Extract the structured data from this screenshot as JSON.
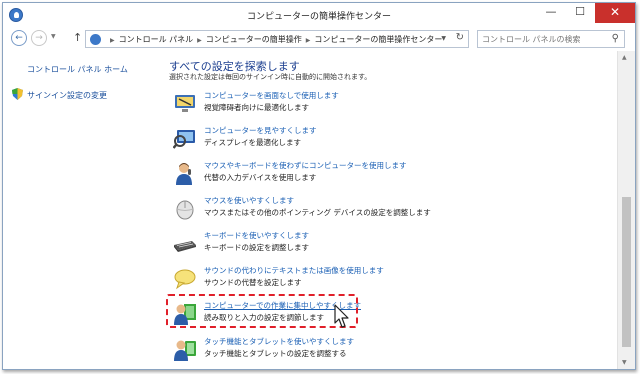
{
  "window": {
    "title": "コンピューターの簡単操作センター",
    "minimize_glyph": "—",
    "maximize_glyph": "☐",
    "close_glyph": "✕"
  },
  "address": {
    "crumbs": [
      "コントロール パネル",
      "コンピューターの簡単操作",
      "コンピューターの簡単操作センター"
    ],
    "search_placeholder": "コントロール パネルの検索"
  },
  "leftnav": {
    "home": "コントロール パネル ホーム",
    "signin": "サインイン設定の変更"
  },
  "main": {
    "title": "すべての設定を探索します",
    "description": "選択された設定は毎回のサインイン時に自動的に開始されます。",
    "items": [
      {
        "link": "コンピューターを画面なしで使用します",
        "sub": "視覚障碍者向けに最適化します",
        "icon": "monitor-off-icon"
      },
      {
        "link": "コンピューターを見やすくします",
        "sub": "ディスプレイを最適化します",
        "icon": "magnifier-monitor-icon"
      },
      {
        "link": "マウスやキーボードを使わずにコンピューターを使用します",
        "sub": "代替の入力デバイスを使用します",
        "icon": "user-microphone-icon"
      },
      {
        "link": "マウスを使いやすくします",
        "sub": "マウスまたはその他のポインティング デバイスの設定を調整します",
        "icon": "mouse-icon"
      },
      {
        "link": "キーボードを使いやすくします",
        "sub": "キーボードの設定を調整します",
        "icon": "keyboard-icon"
      },
      {
        "link": "サウンドの代わりにテキストまたは画像を使用します",
        "sub": "サウンドの代替を設定します",
        "icon": "speech-bubble-icon"
      },
      {
        "link": "コンピューターでの作業に集中しやすくします",
        "sub": "読み取りと入力の設定を調節します",
        "icon": "user-document-icon"
      },
      {
        "link": "タッチ機能とタブレットを使いやすくします",
        "sub": "タッチ機能とタブレットの設定を調整する",
        "icon": "user-tablet-icon"
      }
    ]
  },
  "colors": {
    "link": "#1a5fb4",
    "title": "#1a3d8f",
    "highlight": "#e0202a",
    "close": "#c9302c"
  }
}
